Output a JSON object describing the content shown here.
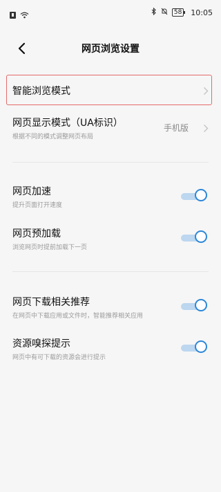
{
  "status_bar": {
    "time": "10:05",
    "battery": "58",
    "icons": [
      "sim-icon",
      "wifi-icon",
      "bluetooth-icon",
      "mute-icon",
      "battery-icon"
    ]
  },
  "header": {
    "title": "网页浏览设置",
    "back_icon": "chevron-left-icon"
  },
  "settings": {
    "smart_mode": {
      "title": "智能浏览模式"
    },
    "display_mode": {
      "title": "网页显示模式（UA标识）",
      "subtitle": "根据不同的模式调整网页布局",
      "value": "手机版"
    },
    "acceleration": {
      "title": "网页加速",
      "subtitle": "提升页面打开速度",
      "on": true
    },
    "preload": {
      "title": "网页预加载",
      "subtitle": "浏览网页时提前加载下一页",
      "on": true
    },
    "download_recommend": {
      "title": "网页下载相关推荐",
      "subtitle": "在网页中下载应用或文件时，智能推荐相关应用",
      "on": true
    },
    "resource_sniff": {
      "title": "资源嗅探提示",
      "subtitle": "网页中有可下载的资源会进行提示",
      "on": true
    }
  },
  "colors": {
    "accent": "#2d87d8",
    "highlight_border": "#e46a6a",
    "background": "#f6f6f6"
  }
}
